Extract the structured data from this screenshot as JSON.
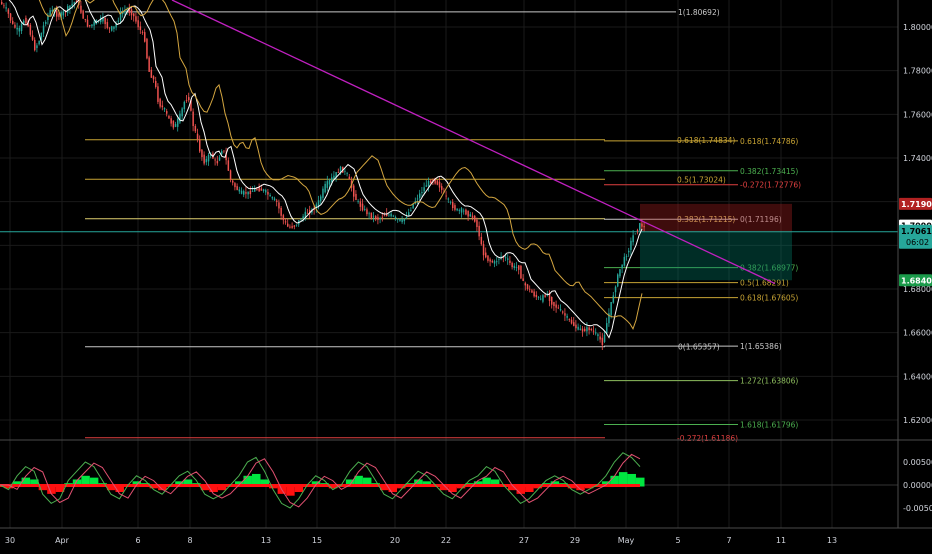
{
  "colors": {
    "background": "#000000",
    "grid": "#1a1a1a",
    "axis_text": "#d1d4dc",
    "candle_up": "#26a69a",
    "candle_down": "#ef5350",
    "fib_gold": "#c8a434",
    "fib_white": "#d8d8d8",
    "fib_green": "#4caf50",
    "fib_red": "#e04040",
    "trendline": "#c020c0",
    "osc_green": "#00e640",
    "osc_red": "#ff1010"
  },
  "chart_data": {
    "type": "candlestick",
    "ylim": [
      1.6,
      1.82
    ],
    "y_ticks": [
      "1.80000",
      "1.78000",
      "1.76000",
      "1.74000",
      "1.72000",
      "1.70000",
      "1.68000",
      "1.66000",
      "1.64000",
      "1.62000"
    ],
    "x_ticks": [
      "30",
      "Apr",
      "6",
      "8",
      "13",
      "15",
      "20",
      "22",
      "27",
      "29",
      "May",
      "5",
      "7",
      "11",
      "13"
    ],
    "price_path": [
      [
        0,
        1.812
      ],
      [
        8,
        1.808
      ],
      [
        14,
        1.801
      ],
      [
        20,
        1.798
      ],
      [
        26,
        1.804
      ],
      [
        30,
        1.8
      ],
      [
        36,
        1.79
      ],
      [
        40,
        1.793
      ],
      [
        46,
        1.802
      ],
      [
        52,
        1.808
      ],
      [
        60,
        1.805
      ],
      [
        66,
        1.807
      ],
      [
        72,
        1.81
      ],
      [
        78,
        1.812
      ],
      [
        84,
        1.805
      ],
      [
        90,
        1.8
      ],
      [
        96,
        1.802
      ],
      [
        104,
        1.804
      ],
      [
        110,
        1.799
      ],
      [
        116,
        1.8
      ],
      [
        122,
        1.806
      ],
      [
        128,
        1.808
      ],
      [
        134,
        1.806
      ],
      [
        140,
        1.8
      ],
      [
        146,
        1.795
      ],
      [
        150,
        1.78
      ],
      [
        156,
        1.775
      ],
      [
        160,
        1.765
      ],
      [
        166,
        1.762
      ],
      [
        170,
        1.758
      ],
      [
        176,
        1.754
      ],
      [
        182,
        1.76
      ],
      [
        186,
        1.766
      ],
      [
        190,
        1.768
      ],
      [
        194,
        1.756
      ],
      [
        198,
        1.75
      ],
      [
        202,
        1.742
      ],
      [
        206,
        1.738
      ],
      [
        212,
        1.742
      ],
      [
        218,
        1.737
      ],
      [
        224,
        1.745
      ],
      [
        228,
        1.738
      ],
      [
        232,
        1.73
      ],
      [
        236,
        1.727
      ],
      [
        242,
        1.724
      ],
      [
        250,
        1.724
      ],
      [
        258,
        1.726
      ],
      [
        266,
        1.725
      ],
      [
        272,
        1.722
      ],
      [
        278,
        1.72
      ],
      [
        284,
        1.712
      ],
      [
        290,
        1.708
      ],
      [
        296,
        1.709
      ],
      [
        302,
        1.712
      ],
      [
        308,
        1.715
      ],
      [
        314,
        1.716
      ],
      [
        320,
        1.72
      ],
      [
        326,
        1.727
      ],
      [
        332,
        1.73
      ],
      [
        336,
        1.732
      ],
      [
        342,
        1.735
      ],
      [
        348,
        1.733
      ],
      [
        352,
        1.728
      ],
      [
        356,
        1.722
      ],
      [
        362,
        1.718
      ],
      [
        368,
        1.715
      ],
      [
        374,
        1.713
      ],
      [
        380,
        1.712
      ],
      [
        386,
        1.714
      ],
      [
        392,
        1.714
      ],
      [
        398,
        1.712
      ],
      [
        404,
        1.711
      ],
      [
        410,
        1.715
      ],
      [
        416,
        1.72
      ],
      [
        422,
        1.724
      ],
      [
        428,
        1.728
      ],
      [
        434,
        1.73
      ],
      [
        440,
        1.728
      ],
      [
        446,
        1.723
      ],
      [
        452,
        1.719
      ],
      [
        458,
        1.716
      ],
      [
        464,
        1.716
      ],
      [
        470,
        1.714
      ],
      [
        476,
        1.712
      ],
      [
        480,
        1.706
      ],
      [
        484,
        1.697
      ],
      [
        490,
        1.693
      ],
      [
        496,
        1.692
      ],
      [
        502,
        1.695
      ],
      [
        508,
        1.694
      ],
      [
        514,
        1.69
      ],
      [
        520,
        1.69
      ],
      [
        524,
        1.683
      ],
      [
        530,
        1.68
      ],
      [
        536,
        1.677
      ],
      [
        542,
        1.675
      ],
      [
        548,
        1.678
      ],
      [
        554,
        1.673
      ],
      [
        560,
        1.671
      ],
      [
        566,
        1.668
      ],
      [
        572,
        1.665
      ],
      [
        578,
        1.662
      ],
      [
        584,
        1.661
      ],
      [
        590,
        1.662
      ],
      [
        596,
        1.66
      ],
      [
        600,
        1.658
      ],
      [
        604,
        1.655
      ],
      [
        607,
        1.662
      ],
      [
        610,
        1.668
      ],
      [
        614,
        1.676
      ],
      [
        618,
        1.684
      ],
      [
        622,
        1.69
      ],
      [
        626,
        1.694
      ],
      [
        630,
        1.698
      ],
      [
        634,
        1.704
      ],
      [
        638,
        1.707
      ],
      [
        642,
        1.71
      ],
      [
        645,
        1.708
      ]
    ],
    "trendline": {
      "from": [
        "≈Mar 25",
        1.85
      ],
      "to": [
        "May 4",
        1.698
      ],
      "color": "#c020c0"
    },
    "fib_left": [
      {
        "label": "1(1.80692)",
        "value": 1.80692,
        "color": "#c8c8c8"
      },
      {
        "label": "0.618(1.74834)",
        "value": 1.74834,
        "color": "#c8a434"
      },
      {
        "label": "0.5(1.73024)",
        "value": 1.73024,
        "color": "#c8a434"
      },
      {
        "label": "0.382(1.71215)",
        "value": 1.71215,
        "color": "#e0d070"
      },
      {
        "label": "0(1.65357)",
        "value": 1.65357,
        "color": "#c8c8c8"
      },
      {
        "label": "-0.272(1.61186)",
        "value": 1.61186,
        "color": "#e04040"
      }
    ],
    "fib_right": [
      {
        "label": "0.618(1.74786)",
        "value": 1.74786,
        "color": "#c8a434"
      },
      {
        "label": "0.382(1.73415)",
        "value": 1.73415,
        "color": "#4caf50"
      },
      {
        "label": "-0.272(1.72776)",
        "value": 1.72776,
        "color": "#e04040"
      },
      {
        "label": "0(1.71196)",
        "value": 1.71196,
        "color": "#c8c8c8"
      },
      {
        "label": "0.382(1.68977)",
        "value": 1.68977,
        "color": "#4caf50"
      },
      {
        "label": "0.5(1.68291)",
        "value": 1.68291,
        "color": "#c8a434"
      },
      {
        "label": "0.618(1.67605)",
        "value": 1.67605,
        "color": "#c8a434"
      },
      {
        "label": "1(1.65386)",
        "value": 1.65386,
        "color": "#c8c8c8"
      },
      {
        "label": "1.272(1.63806)",
        "value": 1.63806,
        "color": "#8fbf5f"
      },
      {
        "label": "1.618(1.61796)",
        "value": 1.61796,
        "color": "#4caf50"
      }
    ],
    "position_box": {
      "entry": 1.7062,
      "stop": 1.719,
      "target": 1.684
    },
    "price_badges": [
      {
        "value": 1.719,
        "label": "1.71900",
        "bg": "#b22222",
        "fg": "#ffffff"
      },
      {
        "value": 1.709,
        "label": "1.70900",
        "bg": "#ffffff",
        "fg": "#000000"
      },
      {
        "value": 1.7062,
        "label": "1.70619",
        "sub": "06:02",
        "bg": "#26a69a",
        "fg": "#000000"
      },
      {
        "value": 1.684,
        "label": "1.68400",
        "bg": "#1a9a4a",
        "fg": "#ffffff"
      }
    ],
    "oscillator": {
      "ylim": [
        -0.008,
        0.008
      ],
      "y_ticks": [
        "0.00500",
        "0.00000",
        "-0.00500"
      ],
      "values": [
        0.0,
        -0.001,
        0.002,
        0.004,
        0.003,
        -0.002,
        -0.004,
        -0.003,
        0.001,
        0.003,
        0.005,
        0.004,
        0.001,
        -0.002,
        -0.003,
        0.0,
        0.002,
        0.001,
        -0.001,
        -0.002,
        0.0,
        0.002,
        0.003,
        0.001,
        -0.002,
        -0.003,
        -0.002,
        0.0,
        0.002,
        0.005,
        0.006,
        0.003,
        -0.001,
        -0.004,
        -0.005,
        -0.003,
        0.0,
        0.002,
        0.001,
        -0.001,
        0.0,
        0.003,
        0.005,
        0.004,
        0.001,
        -0.002,
        -0.003,
        -0.001,
        0.001,
        0.003,
        0.002,
        0.0,
        -0.002,
        -0.003,
        -0.001,
        0.001,
        0.002,
        0.004,
        0.003,
        0.0,
        -0.002,
        -0.004,
        -0.003,
        -0.001,
        0.001,
        0.002,
        0.001,
        -0.001,
        -0.002,
        -0.001,
        0.0,
        0.002,
        0.005,
        0.007,
        0.006,
        0.004
      ]
    }
  }
}
